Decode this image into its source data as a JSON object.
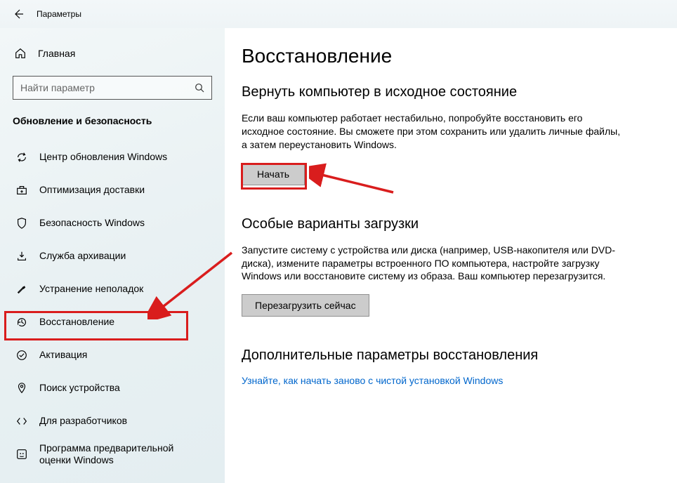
{
  "header": {
    "title": "Параметры"
  },
  "sidebar": {
    "home_label": "Главная",
    "search_placeholder": "Найти параметр",
    "category_label": "Обновление и безопасность",
    "items": [
      {
        "label": "Центр обновления Windows"
      },
      {
        "label": "Оптимизация доставки"
      },
      {
        "label": "Безопасность Windows"
      },
      {
        "label": "Служба архивации"
      },
      {
        "label": "Устранение неполадок"
      },
      {
        "label": "Восстановление"
      },
      {
        "label": "Активация"
      },
      {
        "label": "Поиск устройства"
      },
      {
        "label": "Для разработчиков"
      },
      {
        "label": "Программа предварительной оценки Windows"
      }
    ]
  },
  "content": {
    "page_title": "Восстановление",
    "section1": {
      "title": "Вернуть компьютер в исходное состояние",
      "text": "Если ваш компьютер работает нестабильно, попробуйте восстановить его исходное состояние. Вы сможете при этом сохранить или удалить личные файлы, а затем переустановить Windows.",
      "button": "Начать"
    },
    "section2": {
      "title": "Особые варианты загрузки",
      "text": "Запустите систему с устройства или диска (например, USB-накопителя или DVD-диска), измените параметры встроенного ПО компьютера, настройте загрузку Windows или восстановите систему из образа. Ваш компьютер перезагрузится.",
      "button": "Перезагрузить сейчас"
    },
    "section3": {
      "title": "Дополнительные параметры восстановления",
      "link": "Узнайте, как начать заново с чистой установкой Windows"
    }
  }
}
